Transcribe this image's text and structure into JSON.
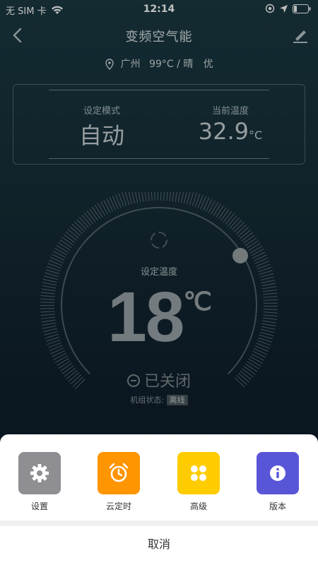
{
  "status": {
    "carrier": "无 SIM 卡",
    "time": "12:14"
  },
  "nav": {
    "title": "变频空气能"
  },
  "location": {
    "city": "广州",
    "weather": "99°C / 晴",
    "air": "优"
  },
  "info": {
    "mode_label": "设定模式",
    "mode_value": "自动",
    "current_label": "当前温度",
    "current_value": "32.9",
    "current_unit": "°C"
  },
  "dial": {
    "set_label": "设定温度",
    "set_value": "18",
    "set_unit": "℃",
    "power_text": "已关闭",
    "unit_state_label": "机组状态:",
    "unit_state_value": "离线"
  },
  "sheet": {
    "actions": [
      {
        "label": "设置",
        "icon": "gear-icon",
        "color": "#8e8e93"
      },
      {
        "label": "云定时",
        "icon": "alarm-clock-icon",
        "color": "#ff9500"
      },
      {
        "label": "高级",
        "icon": "four-petal-icon",
        "color": "#ffcc00"
      },
      {
        "label": "版本",
        "icon": "info-icon",
        "color": "#5856d6"
      }
    ],
    "cancel": "取消"
  }
}
